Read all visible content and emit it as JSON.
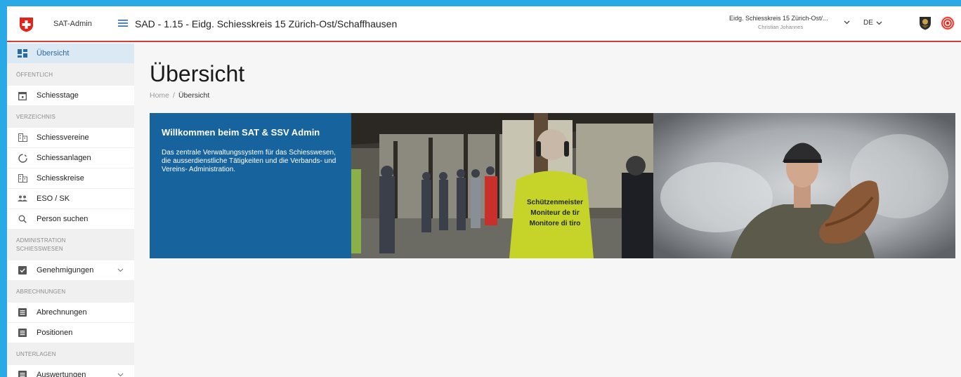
{
  "header": {
    "app_name": "SAT-Admin",
    "context_title": "SAD - 1.15 - Eidg. Schiesskreis 15 Zürich-Ost/Schaffhausen",
    "org_name": "Eidg. Schiesskreis 15 Zürich-Ost/...",
    "user_name": "Christian Johannes",
    "language": "DE"
  },
  "sidebar": {
    "overview": "Übersicht",
    "section_public": "ÖFFENTLICH",
    "shooting_days": "Schiesstage",
    "section_directory": "VERZEICHNIS",
    "clubs": "Schiessvereine",
    "ranges": "Schiessanlagen",
    "districts": "Schiesskreise",
    "eso_sk": "ESO / SK",
    "person_search": "Person suchen",
    "section_admin_1": "ADMINISTRATION",
    "section_admin_2": "SCHIESSWESEN",
    "approvals": "Genehmigungen",
    "section_billing": "ABRECHNUNGEN",
    "billing": "Abrechnungen",
    "positions": "Positionen",
    "section_documents": "UNTERLAGEN",
    "evaluations": "Auswertungen"
  },
  "main": {
    "title": "Übersicht",
    "breadcrumb_home": "Home",
    "breadcrumb_sep": "/",
    "breadcrumb_current": "Übersicht",
    "banner_title": "Willkommen beim SAT & SSV Admin",
    "banner_text": "Das zentrale Verwaltungssystem für das Schiesswesen, die ausserdienstliche Tätigkeiten und die Verbands- und Vereins- Administration.",
    "vest_text_1": "Schützenmeister",
    "vest_text_2": "Moniteur de tir",
    "vest_text_3": "Monitore di tiro"
  },
  "colors": {
    "accent_blue": "#17639e",
    "header_line": "#d13c3c",
    "active_bg": "#dbe9f4",
    "frame": "#29a9e6"
  },
  "icons": [
    "swiss-cross-logo",
    "menu-icon",
    "chevron-down-icon",
    "dashboard-icon",
    "calendar-icon",
    "building-icon",
    "circle-icon",
    "people-icon",
    "search-icon",
    "checkbox-icon",
    "document-icon"
  ]
}
